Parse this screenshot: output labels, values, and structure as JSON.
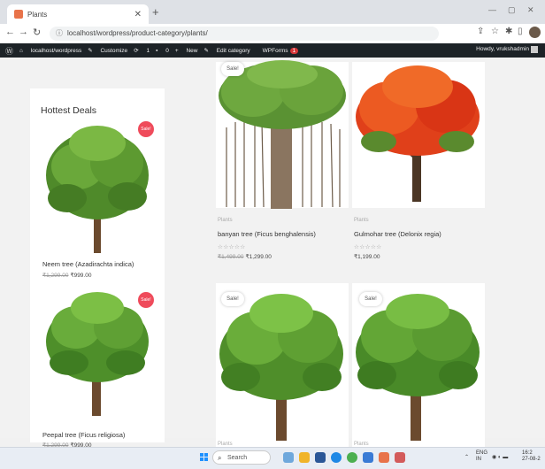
{
  "browser": {
    "tab_title": "Plants",
    "url": "localhost/wordpress/product-category/plants/"
  },
  "wp_admin_bar": {
    "site": "localhost/wordpress",
    "customize": "Customize",
    "updates_count": "1",
    "comments_count": "0",
    "new": "New",
    "edit_category": "Edit category",
    "wpforms": "WPForms",
    "wpforms_badge": "1",
    "howdy": "Howdy, vrukshadmin"
  },
  "sidebar": {
    "title": "Hottest Deals",
    "products": [
      {
        "name": "Neem tree (Azadirachta indica)",
        "old_price": "₹1,299.00",
        "price": "₹999.00",
        "sale": "Sale!"
      },
      {
        "name": "Peepal tree (Ficus religiosa)",
        "old_price": "₹1,299.00",
        "price": "₹999.00",
        "sale": "Sale!"
      }
    ]
  },
  "products": [
    {
      "sale": "Sale!",
      "category": "Plants",
      "name": "banyan tree (Ficus benghalensis)",
      "old_price": "₹1,499.00",
      "price": "₹1,299.00",
      "stars": "☆☆☆☆☆"
    },
    {
      "category": "Plants",
      "name": "Gulmohar tree (Delonix regia)",
      "price": "₹1,199.00",
      "stars": "☆☆☆☆☆"
    },
    {
      "sale": "Sale!",
      "category": "Plants"
    },
    {
      "sale": "Sale!",
      "category": "Plants"
    }
  ],
  "taskbar": {
    "search": "Search",
    "lang": "ENG",
    "region": "IN",
    "time": "16:2",
    "date": "27-08-2"
  },
  "colors": {
    "sale_badge": "#ef4b5b",
    "admin_bar": "#1d2327"
  }
}
